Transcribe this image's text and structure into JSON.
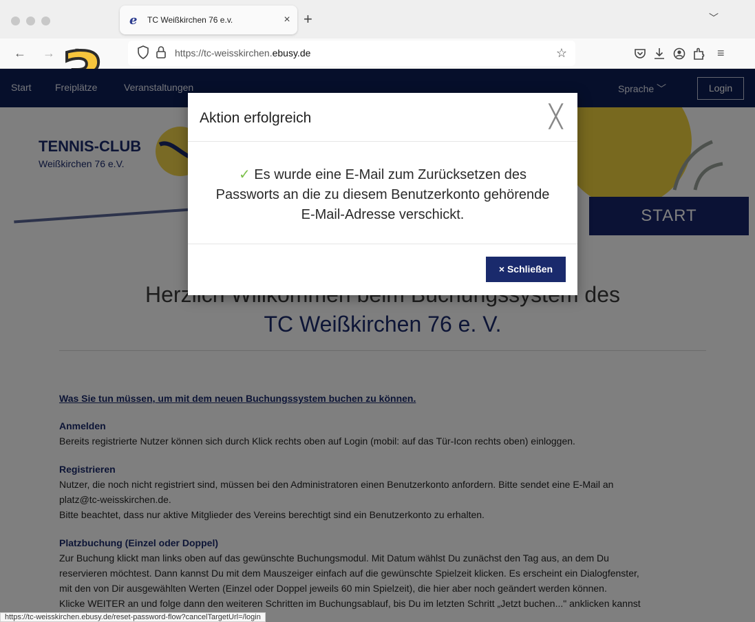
{
  "browser": {
    "tab_title": "TC Weißkirchen 76 e.v.",
    "tab_close": "×",
    "new_tab": "+",
    "tabs_menu": "﹀",
    "url_prefix": "https://tc-weisskirchen.",
    "url_domain": "ebusy.de",
    "annotation_number": "3",
    "status_url": "https://tc-weisskirchen.ebusy.de/reset-password-flow?cancelTargetUrl=/login"
  },
  "site": {
    "nav": [
      "Start",
      "Freiplätze",
      "Veranstaltungen"
    ],
    "language": "Sprache",
    "login": "Login",
    "logo_line1": "TENNIS-CLUB",
    "logo_line2": "Weißkirchen 76 e.V.",
    "start_banner": "START",
    "welcome_line1": "Herzlich Willkommen beim Buchungssystem des",
    "welcome_line2": "TC Weißkirchen 76  e. V.",
    "section_link": "Was Sie tun müssen, um mit dem neuen Buchungssystem buchen zu können.",
    "anmelden_title": "Anmelden",
    "anmelden_text": "Bereits registrierte Nutzer können sich durch Klick rechts oben auf Login (mobil: auf das Tür-Icon rechts oben) einloggen.",
    "registrieren_title": "Registrieren",
    "registrieren_text1": "Nutzer, die noch nicht registriert sind, müssen bei den Administratoren einen Benutzerkonto anfordern. Bitte sendet eine E-Mail an",
    "registrieren_text2": "platz@tc-weisskirchen.de.",
    "registrieren_text3": "Bitte beachtet, dass nur aktive Mitglieder des Vereins berechtigt sind ein Benutzerkonto zu erhalten.",
    "platzbuchung_title": "Platzbuchung (Einzel oder Doppel)",
    "platzbuchung_text1": "Zur Buchung klickt man links oben auf das gewünschte Buchungsmodul. Mit Datum wählst Du zunächst den Tag aus, an dem Du",
    "platzbuchung_text2": "reservieren möchtest. Dann kannst Du mit dem Mauszeiger einfach auf die gewünschte Spielzeit klicken. Es erscheint ein Dialogfenster,",
    "platzbuchung_text3": "mit den von Dir ausgewählten Werten (Einzel oder Doppel jeweils 60 min Spielzeit), die hier aber noch geändert werden können.",
    "platzbuchung_text4": "Klicke WEITER an und folge dann den weiteren Schritten im Buchungsablauf, bis Du im letzten Schritt „Jetzt buchen...\" anklicken kannst"
  },
  "modal": {
    "title": "Aktion erfolgreich",
    "close_symbol": "╳",
    "check": "✓",
    "message": "Es wurde eine E-Mail zum Zurücksetzen des Passworts an die zu diesem Benutzerkonto gehörende E-Mail-Adresse verschickt.",
    "button_icon": "×",
    "button_label": "Schließen"
  },
  "colors": {
    "site_nav": "#0d1f57",
    "brand": "#1a2a6c",
    "success": "#7cc04b",
    "annotation": "#f6c53d"
  }
}
